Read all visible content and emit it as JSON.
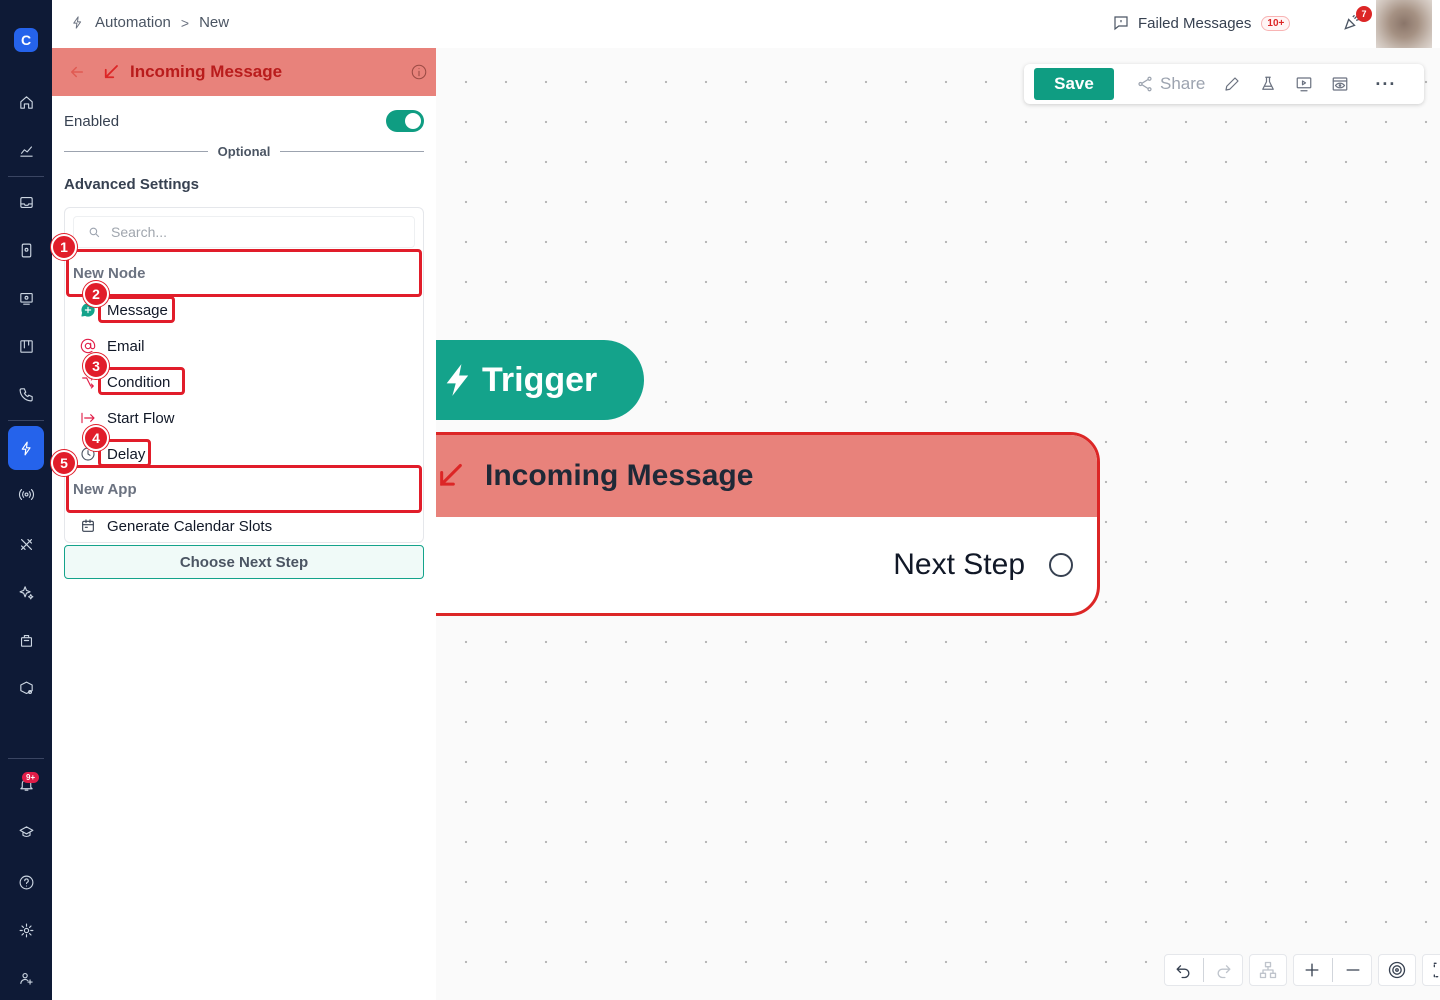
{
  "app": {
    "logo_letter": "C"
  },
  "breadcrumb": {
    "parent": "Automation",
    "separator": ">",
    "current": "New"
  },
  "topbar": {
    "failed_label": "Failed Messages",
    "failed_count": "10+",
    "notifications_count": "7"
  },
  "nav": {
    "notifications_badge": "9+",
    "active_item": "automation"
  },
  "panel": {
    "title": "Incoming Message",
    "enabled_label": "Enabled",
    "enabled": true,
    "optional_label": "Optional",
    "advanced_label": "Advanced Settings",
    "search_placeholder": "Search...",
    "group_new_node": "New Node",
    "node_items": [
      "Message",
      "Email",
      "Condition",
      "Start Flow",
      "Delay"
    ],
    "group_new_app": "New App",
    "app_items": [
      "Generate Calendar Slots"
    ],
    "choose_label": "Choose Next Step"
  },
  "toolbar": {
    "save_label": "Save",
    "share_label": "Share"
  },
  "canvas": {
    "trigger_label": "Trigger",
    "node_title": "Incoming Message",
    "next_step_label": "Next Step"
  },
  "annotations": [
    "1",
    "2",
    "3",
    "4",
    "5"
  ],
  "colors": {
    "nav_bg": "#0e1a36",
    "accent_blue": "#2563eb",
    "teal": "#14a38b",
    "node_header": "#e8827b",
    "highlight_red": "#e11d2a"
  }
}
